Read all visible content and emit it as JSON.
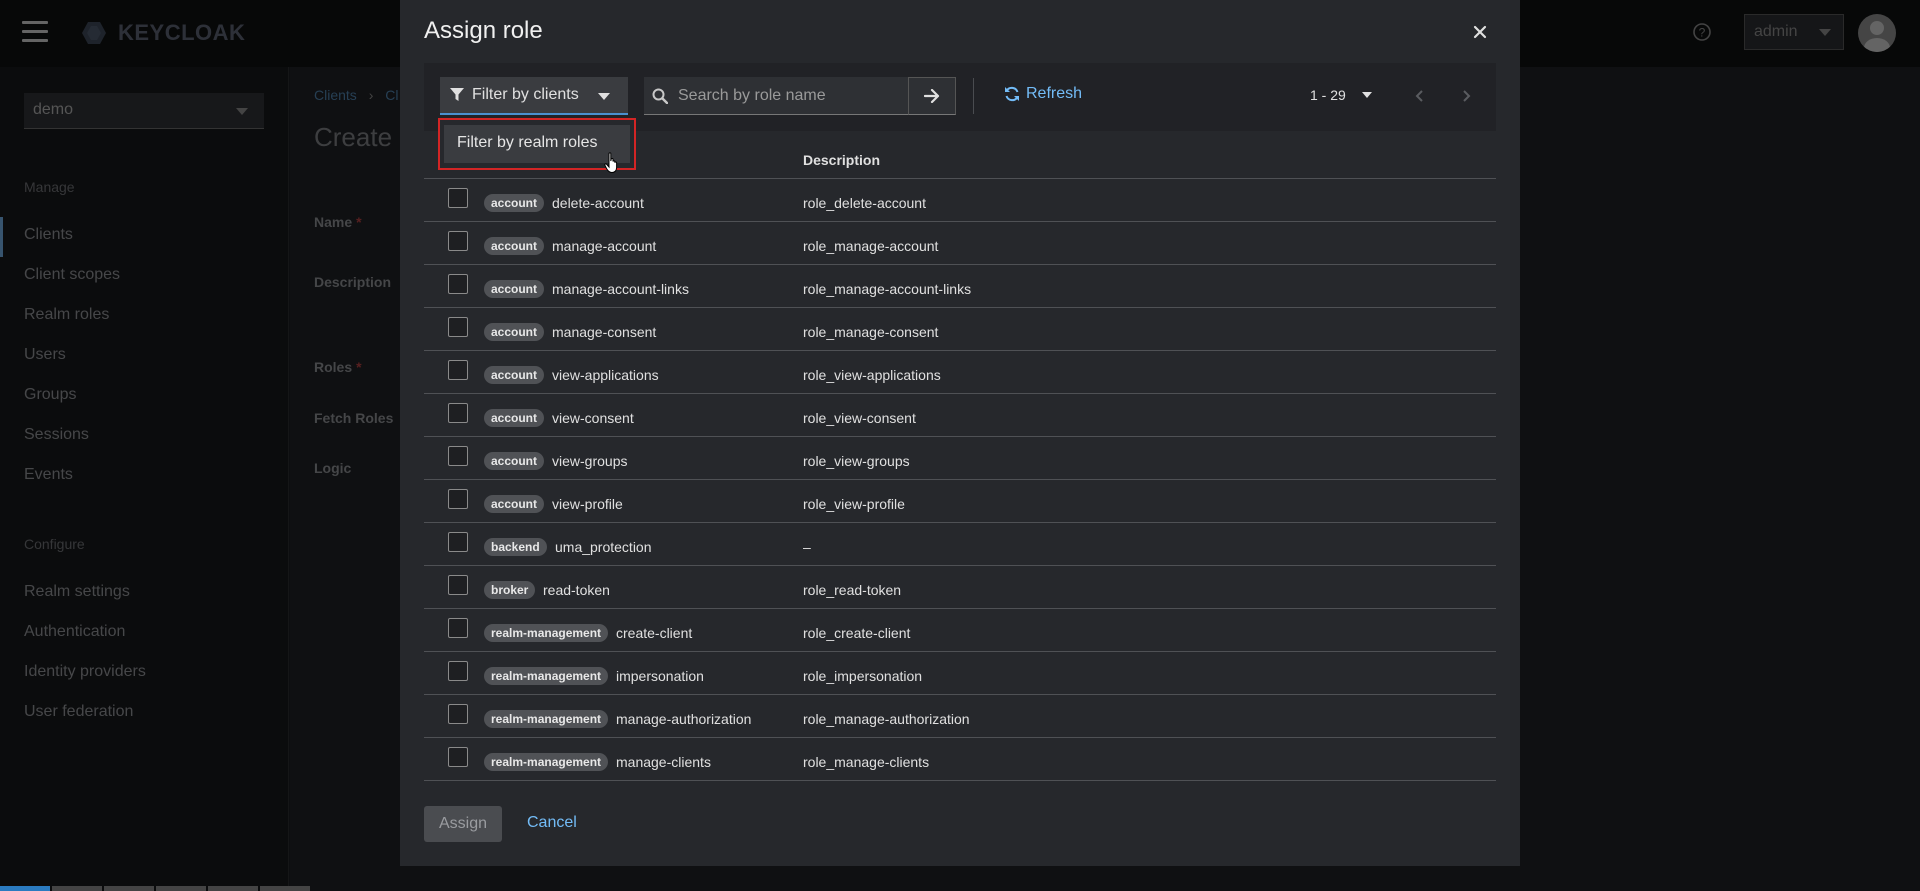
{
  "masthead": {
    "logo_text": "KEYCLOAK",
    "user": "admin"
  },
  "sidebar": {
    "realm": "demo",
    "sections": [
      {
        "title": "Manage",
        "items": [
          "Clients",
          "Client scopes",
          "Realm roles",
          "Users",
          "Groups",
          "Sessions",
          "Events"
        ]
      },
      {
        "title": "Configure",
        "items": [
          "Realm settings",
          "Authentication",
          "Identity providers",
          "User federation"
        ]
      }
    ],
    "active_item": "Clients"
  },
  "page": {
    "breadcrumb_first": "Clients",
    "breadcrumb_second": "Cl",
    "title": "Create r",
    "labels": {
      "name": "Name",
      "description": "Description",
      "roles": "Roles",
      "fetch_roles": "Fetch Roles",
      "logic": "Logic"
    }
  },
  "modal": {
    "title": "Assign role",
    "filter_label": "Filter by clients",
    "filter_option": "Filter by realm roles",
    "search_placeholder": "Search by role name",
    "refresh_label": "Refresh",
    "pagination": "1 - 29",
    "columns": {
      "name": "",
      "description": "Description"
    },
    "rows": [
      {
        "client": "account",
        "role": "delete-account",
        "description": "role_delete-account"
      },
      {
        "client": "account",
        "role": "manage-account",
        "description": "role_manage-account"
      },
      {
        "client": "account",
        "role": "manage-account-links",
        "description": "role_manage-account-links"
      },
      {
        "client": "account",
        "role": "manage-consent",
        "description": "role_manage-consent"
      },
      {
        "client": "account",
        "role": "view-applications",
        "description": "role_view-applications"
      },
      {
        "client": "account",
        "role": "view-consent",
        "description": "role_view-consent"
      },
      {
        "client": "account",
        "role": "view-groups",
        "description": "role_view-groups"
      },
      {
        "client": "account",
        "role": "view-profile",
        "description": "role_view-profile"
      },
      {
        "client": "backend",
        "role": "uma_protection",
        "description": "–"
      },
      {
        "client": "broker",
        "role": "read-token",
        "description": "role_read-token"
      },
      {
        "client": "realm-management",
        "role": "create-client",
        "description": "role_create-client"
      },
      {
        "client": "realm-management",
        "role": "impersonation",
        "description": "role_impersonation"
      },
      {
        "client": "realm-management",
        "role": "manage-authorization",
        "description": "role_manage-authorization"
      },
      {
        "client": "realm-management",
        "role": "manage-clients",
        "description": "role_manage-clients"
      }
    ],
    "assign_label": "Assign",
    "cancel_label": "Cancel"
  },
  "colors": {
    "accent": "#73bcf7",
    "highlight_border": "#d32525"
  }
}
